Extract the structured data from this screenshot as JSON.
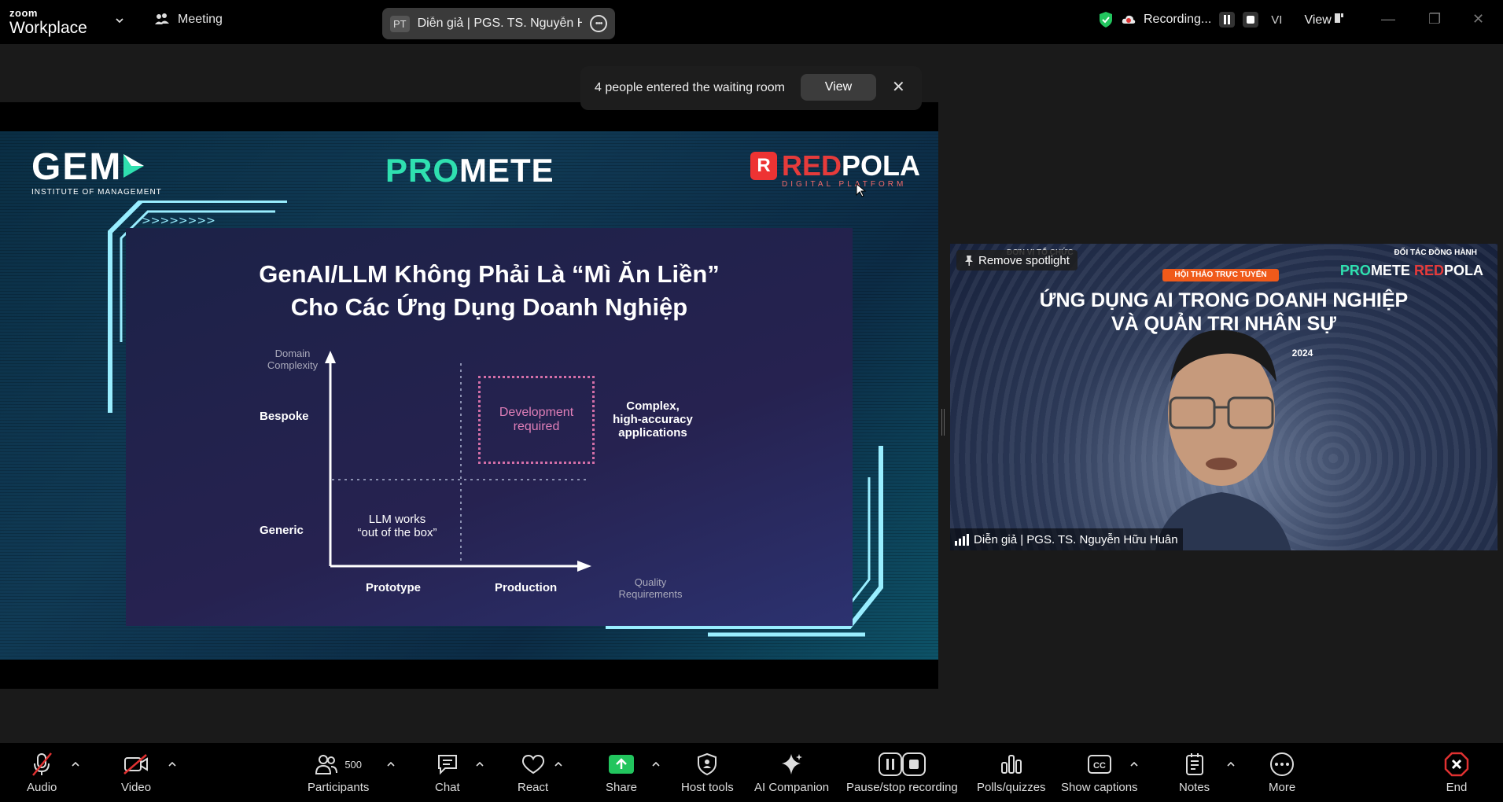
{
  "app": {
    "logo_small": "zoom",
    "logo_big": "Workplace"
  },
  "meeting": {
    "label": "Meeting"
  },
  "speaker_pill": {
    "initials": "PT",
    "name": "Diễn giả | PGS. TS. Nguyễn Hữu Huân"
  },
  "recording": {
    "label": "Recording...",
    "lang": "VI",
    "view": "View"
  },
  "waiting_room": {
    "message": "4 people entered the waiting room",
    "view_label": "View"
  },
  "slide": {
    "gem": "GEM",
    "gem_sub": "INSTITUTE OF MANAGEMENT",
    "promete_a": "PRO",
    "promete_b": "METE",
    "redpola_a": "RED",
    "redpola_b": "POLA",
    "redpola_sub": "DIGITAL PLATFORM",
    "title_1": "GenAI/LLM Không Phải Là “Mì Ăn Liền”",
    "title_2": "Cho Các Ứng Dụng Doanh Nghiệp",
    "y_axis_label_1": "Domain",
    "y_axis_label_2": "Complexity",
    "bespoke": "Bespoke",
    "generic": "Generic",
    "dev_1": "Development",
    "dev_2": "required",
    "complex_1": "Complex,",
    "complex_2": "high-accuracy",
    "complex_3": "applications",
    "llm_1": "LLM works",
    "llm_2": "“out of the box”",
    "prototype": "Prototype",
    "production": "Production",
    "x_axis_label_1": "Quality",
    "x_axis_label_2": "Requirements"
  },
  "video_tile": {
    "org_label": "ĐƠN VỊ TỔ CHỨC",
    "partner_label": "ĐỐI TÁC ĐỒNG HÀNH",
    "badge": "HỘI THẢO TRỰC TUYẾN",
    "headline_1": "ỨNG DỤNG AI TRONG DOANH NGHIỆP",
    "headline_2": "VÀ QUẢN TRỊ NHÂN SỰ",
    "date": "2024",
    "remove_spotlight": "Remove spotlight",
    "participant_name": "Diễn giả | PGS. TS. Nguyễn Hữu Huân"
  },
  "toolbar": {
    "audio": "Audio",
    "video": "Video",
    "participants": "Participants",
    "participants_count": "500",
    "chat": "Chat",
    "react": "React",
    "share": "Share",
    "host_tools": "Host tools",
    "ai_companion": "AI Companion",
    "pause_stop": "Pause/stop recording",
    "polls": "Polls/quizzes",
    "captions": "Show captions",
    "notes": "Notes",
    "more": "More",
    "end": "End"
  },
  "colors": {
    "accent_green": "#2fe0b0",
    "share_green": "#22c55e",
    "end_red": "#e03131",
    "dev_pink": "#d46fa8"
  }
}
